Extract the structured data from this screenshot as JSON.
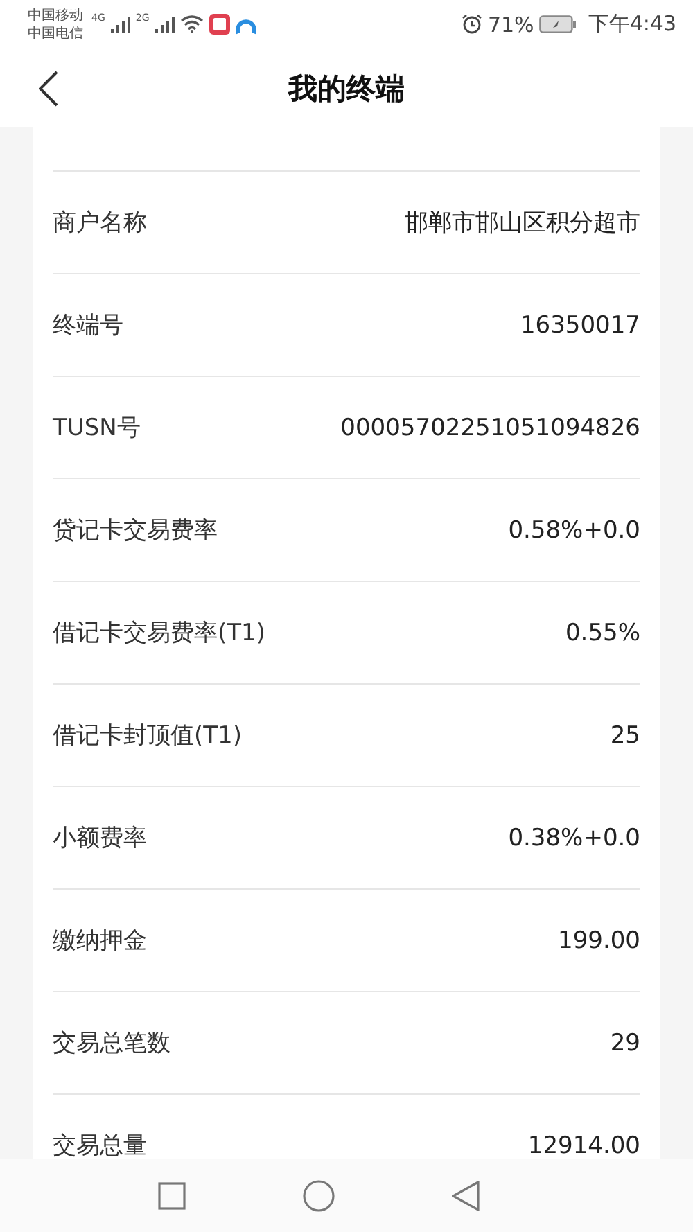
{
  "status_bar": {
    "carriers": [
      "中国移动",
      "中国电信"
    ],
    "networks": [
      "4G",
      "2G"
    ],
    "battery": "71%",
    "time": "下午4:43"
  },
  "header": {
    "title": "我的终端"
  },
  "rows": [
    {
      "label": "商户名称",
      "value": "邯郸市邯山区积分超市"
    },
    {
      "label": "终端号",
      "value": "16350017"
    },
    {
      "label": "TUSN号",
      "value": "00005702251051094826"
    },
    {
      "label": "贷记卡交易费率",
      "value": "0.58%+0.0"
    },
    {
      "label": "借记卡交易费率(T1)",
      "value": "0.55%"
    },
    {
      "label": "借记卡封顶值(T1)",
      "value": "25"
    },
    {
      "label": "小额费率",
      "value": "0.38%+0.0"
    },
    {
      "label": "缴纳押金",
      "value": "199.00"
    },
    {
      "label": "交易总笔数",
      "value": "29"
    },
    {
      "label": "交易总量",
      "value": "12914.00"
    }
  ]
}
